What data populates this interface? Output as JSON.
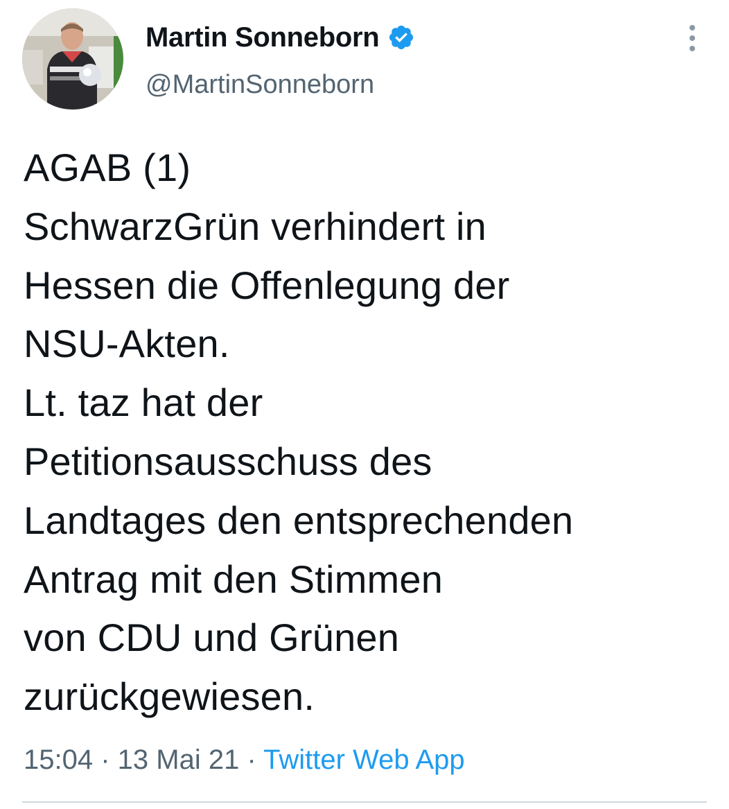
{
  "author": {
    "display_name": "Martin Sonneborn",
    "handle": "@MartinSonneborn",
    "verified": true,
    "avatar_icon": "profile-photo"
  },
  "tweet": {
    "lines": [
      "AGAB (1)",
      "SchwarzGrün verhindert in",
      "Hessen die Offenlegung der",
      "NSU-Akten.",
      "Lt. taz hat der",
      "Petitionsausschuss des",
      "Landtages den entsprechenden",
      "Antrag mit den Stimmen",
      "von CDU und Grünen",
      "zurückgewiesen."
    ]
  },
  "meta": {
    "time": "15:04",
    "separator": " · ",
    "date": "13 Mai 21",
    "source": "Twitter Web App"
  },
  "colors": {
    "text": "#0f1419",
    "secondary": "#536471",
    "accent": "#1d9bf0",
    "divider": "#cfd9de"
  }
}
